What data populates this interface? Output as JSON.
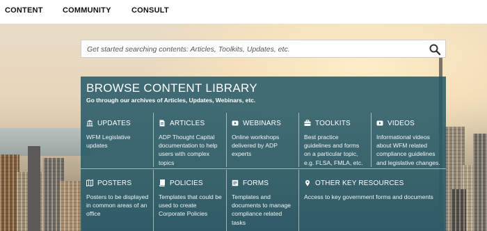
{
  "nav": {
    "items": [
      {
        "label": "CONTENT"
      },
      {
        "label": "COMMUNITY"
      },
      {
        "label": "CONSULT"
      }
    ]
  },
  "search": {
    "placeholder": "Get started searching contents: Articles, Toolkits, Updates, etc.",
    "icon": "search-icon"
  },
  "library": {
    "title": "BROWSE CONTENT LIBRARY",
    "subtitle": "Go through our archives of Articles, Updates, Webinars, etc.",
    "categories": [
      {
        "icon": "bank-icon",
        "label": "UPDATES",
        "description": "WFM Legislative updates"
      },
      {
        "icon": "document-icon",
        "label": "ARTICLES",
        "description": "ADP Thought Capital documentation to help users with complex topics"
      },
      {
        "icon": "play-icon",
        "label": "WEBINARS",
        "description": "Online workshops delivered by ADP experts"
      },
      {
        "icon": "briefcase-icon",
        "label": "TOOLKITS",
        "description": "Best practice guidelines and forms on a particular topic, e.g. FLSA, FMLA, etc."
      },
      {
        "icon": "play-icon",
        "label": "VIDEOS",
        "description": "Informational videos about WFM related compliance guidelines and legislative changes."
      },
      {
        "icon": "map-icon",
        "label": "POSTERS",
        "description": "Posters to be displayed in common areas of an office"
      },
      {
        "icon": "book-icon",
        "label": "POLICIES",
        "description": "Templates that could be used to create Corporate Policies"
      },
      {
        "icon": "form-icon",
        "label": "FORMS",
        "description": "Templates and documents to manage compliance related tasks"
      },
      {
        "icon": "location-pin-icon",
        "label": "OTHER KEY RESOURCES",
        "description": "Access to key government forms and documents"
      }
    ]
  },
  "colors": {
    "panel": "#245868",
    "nav_text": "#111111"
  }
}
